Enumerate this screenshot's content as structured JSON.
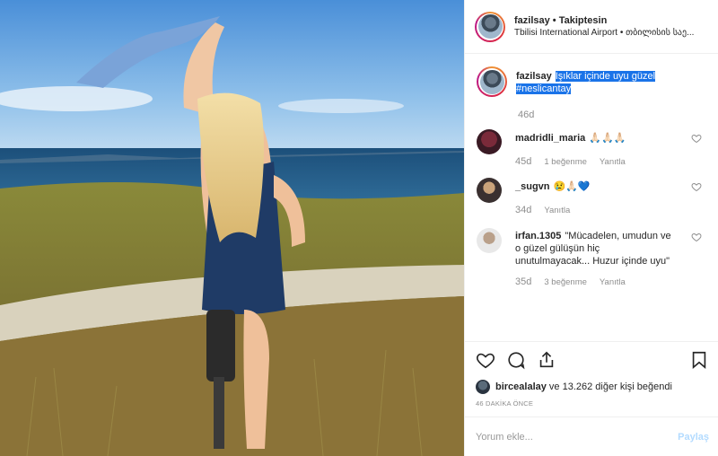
{
  "header": {
    "username": "fazilsay",
    "separator": " • ",
    "follow_label": "Takiptesin",
    "location": "Tbilisi International Airport • თბილისის საე..."
  },
  "caption": {
    "username": "fazilsay",
    "text": "Işıklar içinde uyu güzel #neslicantay",
    "time": "46d"
  },
  "comments": [
    {
      "username": "madridli_maria",
      "text": "🙏🏻🙏🏻🙏🏻",
      "time": "45d",
      "likes": "1 beğenme",
      "reply": "Yanıtla"
    },
    {
      "username": "_sugvn",
      "text": "😢🙏🏻💙",
      "time": "34d",
      "likes": "",
      "reply": "Yanıtla"
    },
    {
      "username": "irfan.1305",
      "text": "\"Mücadelen, umudun ve o güzel gülüşün hiç unutulmayacak... Huzur içinde uyu\"",
      "time": "35d",
      "likes": "3 beğenme",
      "reply": "Yanıtla"
    }
  ],
  "likes": {
    "user": "bircealalay",
    "rest": " ve 13.262 diğer kişi beğendi"
  },
  "time_ago": "46 DAKİKA ÖNCE",
  "add_comment": {
    "placeholder": "Yorum ekle...",
    "post_label": "Paylaş"
  },
  "colors": {
    "link": "#1a73e8",
    "post_disabled": "#b3dbff"
  }
}
